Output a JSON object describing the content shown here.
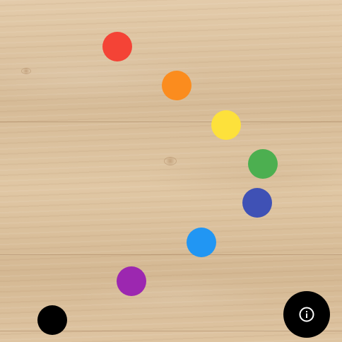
{
  "board": {
    "texture": "wood-grain"
  },
  "dots": [
    {
      "id": "red",
      "color": "#f44336"
    },
    {
      "id": "orange",
      "color": "#fb8c1e"
    },
    {
      "id": "yellow",
      "color": "#fde13b"
    },
    {
      "id": "green",
      "color": "#4caf50"
    },
    {
      "id": "indigo",
      "color": "#3f51b5"
    },
    {
      "id": "blue",
      "color": "#2196f3"
    },
    {
      "id": "purple",
      "color": "#9c27b0"
    },
    {
      "id": "black",
      "color": "#000000"
    }
  ],
  "info_button": {
    "icon": "info-icon",
    "background": "#000000",
    "icon_color": "#ffffff"
  }
}
